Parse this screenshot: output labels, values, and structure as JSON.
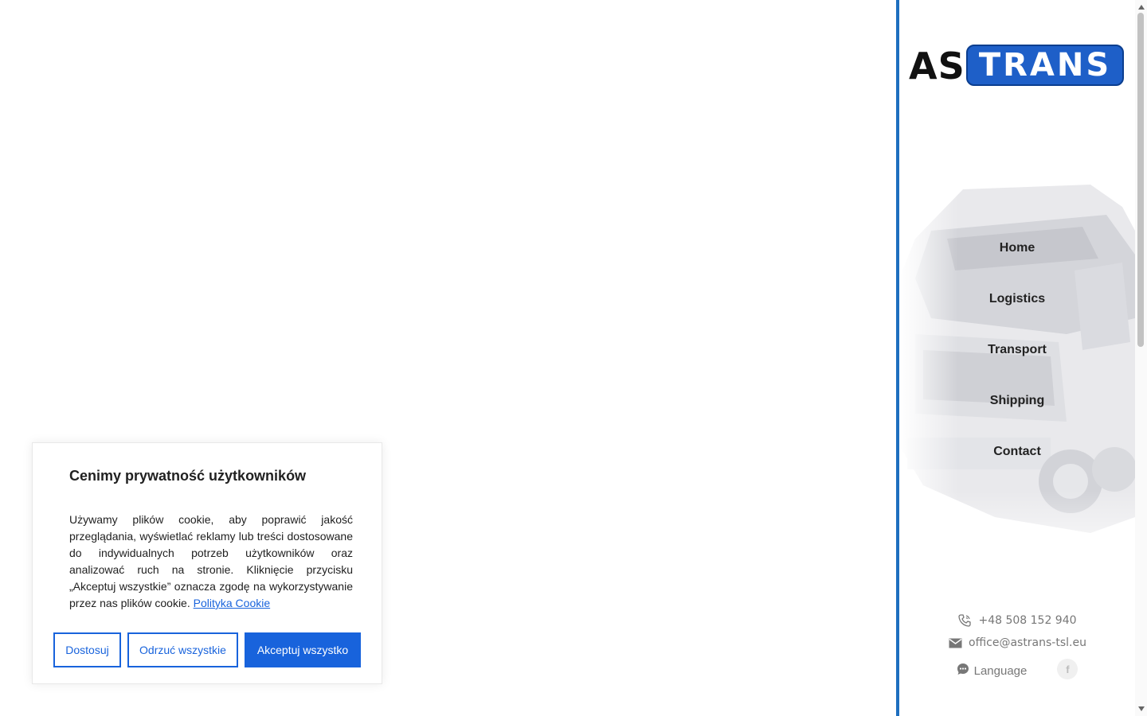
{
  "brand": {
    "logo_left": "AS",
    "logo_right": "TRANS",
    "colors": {
      "accent": "#1e6fbf",
      "logo_blue": "#1e5fc8",
      "button_blue": "#1863dc"
    }
  },
  "nav": {
    "items": [
      {
        "label": "Home"
      },
      {
        "label": "Logistics"
      },
      {
        "label": "Transport"
      },
      {
        "label": "Shipping"
      },
      {
        "label": "Contact"
      }
    ]
  },
  "contact": {
    "phone": "+48 508 152 940",
    "phone_icon": "phone-icon",
    "email": "office@astrans-tsl.eu",
    "email_icon": "envelope-icon",
    "language_label": "Language",
    "language_icon": "chat-bubble-icon",
    "social_icon": "facebook-icon",
    "social_glyph": "f"
  },
  "cookie": {
    "title": "Cenimy prywatność użytkowników",
    "body": "Używamy plików cookie, aby poprawić jakość przeglądania, wyświetlać reklamy lub treści dostosowane do indywidualnych potrzeb użytkowników oraz analizować ruch na stronie. Kliknięcie przycisku „Akceptuj wszystkie” oznacza zgodę na wykorzystywanie przez nas plików cookie.",
    "policy_link": "Polityka Cookie",
    "buttons": {
      "customize": "Dostosuj",
      "reject": "Odrzuć wszystkie",
      "accept": "Akceptuj wszystko"
    }
  }
}
